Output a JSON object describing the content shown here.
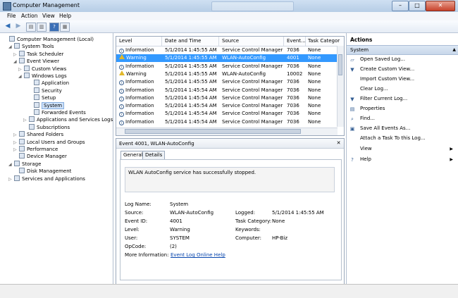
{
  "window": {
    "title": "Computer Management"
  },
  "menu": [
    "File",
    "Action",
    "View",
    "Help"
  ],
  "tree": [
    {
      "label": "Computer Management (Local)",
      "icon": "computer-icon",
      "twisty": ""
    },
    {
      "label": "System Tools",
      "icon": "tools-icon",
      "twisty": "◢"
    },
    {
      "label": "Task Scheduler",
      "icon": "clock-icon",
      "twisty": "▷"
    },
    {
      "label": "Event Viewer",
      "icon": "event-viewer-icon",
      "twisty": "◢"
    },
    {
      "label": "Custom Views",
      "icon": "folder-icon",
      "twisty": "▷"
    },
    {
      "label": "Windows Logs",
      "icon": "folder-icon",
      "twisty": "◢"
    },
    {
      "label": "Application",
      "icon": "log-icon",
      "twisty": ""
    },
    {
      "label": "Security",
      "icon": "log-icon",
      "twisty": ""
    },
    {
      "label": "Setup",
      "icon": "log-icon",
      "twisty": ""
    },
    {
      "label": "System",
      "icon": "log-icon",
      "twisty": "",
      "selected": true
    },
    {
      "label": "Forwarded Events",
      "icon": "log-icon",
      "twisty": ""
    },
    {
      "label": "Applications and Services Logs",
      "icon": "folder-icon",
      "twisty": "▷"
    },
    {
      "label": "Subscriptions",
      "icon": "subscription-icon",
      "twisty": ""
    },
    {
      "label": "Shared Folders",
      "icon": "shared-folder-icon",
      "twisty": "▷"
    },
    {
      "label": "Local Users and Groups",
      "icon": "users-icon",
      "twisty": "▷"
    },
    {
      "label": "Performance",
      "icon": "performance-icon",
      "twisty": "▷"
    },
    {
      "label": "Device Manager",
      "icon": "device-manager-icon",
      "twisty": ""
    },
    {
      "label": "Storage",
      "icon": "storage-icon",
      "twisty": "◢"
    },
    {
      "label": "Disk Management",
      "icon": "disk-icon",
      "twisty": ""
    },
    {
      "label": "Services and Applications",
      "icon": "services-icon",
      "twisty": "▷"
    }
  ],
  "grid": {
    "columns": [
      "Level",
      "Date and Time",
      "Source",
      "Event...",
      "Task Categor"
    ],
    "rows": [
      {
        "level": "Information",
        "type": "info",
        "date": "5/1/2014 1:45:55 AM",
        "source": "Service Control Manager",
        "event": "7036",
        "task": "None"
      },
      {
        "level": "Warning",
        "type": "warn",
        "date": "5/1/2014 1:45:55 AM",
        "source": "WLAN-AutoConfig",
        "event": "4001",
        "task": "None",
        "selected": true
      },
      {
        "level": "Information",
        "type": "info",
        "date": "5/1/2014 1:45:55 AM",
        "source": "Service Control Manager",
        "event": "7036",
        "task": "None"
      },
      {
        "level": "Warning",
        "type": "warn",
        "date": "5/1/2014 1:45:55 AM",
        "source": "WLAN-AutoConfig",
        "event": "10002",
        "task": "None"
      },
      {
        "level": "Information",
        "type": "info",
        "date": "5/1/2014 1:45:55 AM",
        "source": "Service Control Manager",
        "event": "7036",
        "task": "None"
      },
      {
        "level": "Information",
        "type": "info",
        "date": "5/1/2014 1:45:54 AM",
        "source": "Service Control Manager",
        "event": "7036",
        "task": "None"
      },
      {
        "level": "Information",
        "type": "info",
        "date": "5/1/2014 1:45:54 AM",
        "source": "Service Control Manager",
        "event": "7036",
        "task": "None"
      },
      {
        "level": "Information",
        "type": "info",
        "date": "5/1/2014 1:45:54 AM",
        "source": "Service Control Manager",
        "event": "7036",
        "task": "None"
      },
      {
        "level": "Information",
        "type": "info",
        "date": "5/1/2014 1:45:54 AM",
        "source": "Service Control Manager",
        "event": "7036",
        "task": "None"
      },
      {
        "level": "Information",
        "type": "info",
        "date": "5/1/2014 1:45:54 AM",
        "source": "Service Control Manager",
        "event": "7036",
        "task": "None"
      }
    ]
  },
  "detail": {
    "title": "Event 4001, WLAN-AutoConfig",
    "tabs": [
      "General",
      "Details"
    ],
    "message": "WLAN AutoConfig service has successfully stopped.",
    "fields": {
      "log_name_label": "Log Name:",
      "log_name": "System",
      "source_label": "Source:",
      "source": "WLAN-AutoConfig",
      "logged_label": "Logged:",
      "logged": "5/1/2014 1:45:55 AM",
      "event_id_label": "Event ID:",
      "event_id": "4001",
      "task_label": "Task Category:",
      "task": "None",
      "level_label": "Level:",
      "level": "Warning",
      "keywords_label": "Keywords:",
      "user_label": "User:",
      "user": "SYSTEM",
      "computer_label": "Computer:",
      "computer": "HP-Biz",
      "opcode_label": "OpCode:",
      "opcode": "(2)",
      "more_info_label": "More Information:",
      "more_info_link": "Event Log Online Help"
    }
  },
  "actions": {
    "title": "Actions",
    "section": "System",
    "items": [
      {
        "label": "Open Saved Log...",
        "icon": "open-folder-icon"
      },
      {
        "label": "Create Custom View...",
        "icon": "filter-add-icon"
      },
      {
        "label": "Import Custom View...",
        "icon": ""
      },
      {
        "label": "Clear Log...",
        "icon": ""
      },
      {
        "label": "Filter Current Log...",
        "icon": "filter-icon"
      },
      {
        "label": "Properties",
        "icon": "properties-icon"
      },
      {
        "label": "Find...",
        "icon": "find-icon"
      },
      {
        "label": "Save All Events As...",
        "icon": "save-icon"
      },
      {
        "label": "Attach a Task To this Log...",
        "icon": ""
      },
      {
        "label": "View",
        "icon": "",
        "submenu": true
      },
      {
        "label": "Help",
        "icon": "help-icon",
        "submenu": true
      }
    ]
  }
}
